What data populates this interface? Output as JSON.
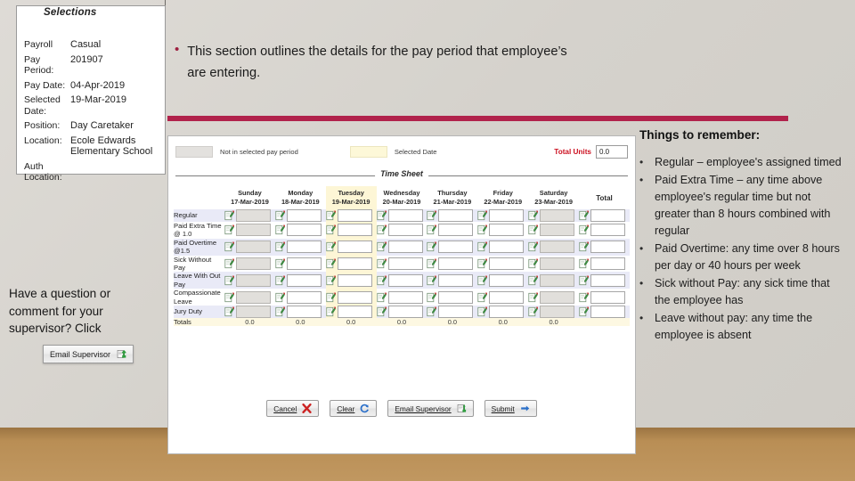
{
  "slide": {
    "bullet": {
      "marker": "•",
      "text": "This section outlines the details for the pay period that employee’s are entering."
    },
    "question_text": "Have a question or comment for your supervisor? Click",
    "floating_button": {
      "label": "Email Supervisor",
      "icon": "email-export-icon"
    }
  },
  "selections": {
    "legend": "Selections",
    "rows": [
      {
        "key": "Payroll",
        "value": "Casual"
      },
      {
        "key": "Pay Period:",
        "value": "201907"
      },
      {
        "key": "Pay Date:",
        "value": "04-Apr-2019"
      },
      {
        "key": "Selected Date:",
        "value": "19-Mar-2019"
      },
      {
        "key": "Position:",
        "value": "Day Caretaker"
      },
      {
        "key": "Location:",
        "value": "Ecole Edwards Elementary School"
      },
      {
        "key": "Auth Location:",
        "value": ""
      }
    ]
  },
  "timesheet": {
    "legend": {
      "not_in_period": "Not in selected pay period",
      "selected_date": "Selected Date",
      "total_units_label": "Total Units",
      "total_units_value": "0.0"
    },
    "section_title": "Time Sheet",
    "row_header_blank": "",
    "total_column_header": "Total",
    "days": [
      {
        "name": "Sunday",
        "date": "17-Mar-2019",
        "in_period": false,
        "selected": false
      },
      {
        "name": "Monday",
        "date": "18-Mar-2019",
        "in_period": true,
        "selected": false
      },
      {
        "name": "Tuesday",
        "date": "19-Mar-2019",
        "in_period": true,
        "selected": true
      },
      {
        "name": "Wednesday",
        "date": "20-Mar-2019",
        "in_period": true,
        "selected": false
      },
      {
        "name": "Thursday",
        "date": "21-Mar-2019",
        "in_period": true,
        "selected": false
      },
      {
        "name": "Friday",
        "date": "22-Mar-2019",
        "in_period": true,
        "selected": false
      },
      {
        "name": "Saturday",
        "date": "23-Mar-2019",
        "in_period": false,
        "selected": false
      }
    ],
    "rows": [
      {
        "label": "Regular",
        "values": [
          "",
          "",
          "",
          "",
          "",
          "",
          ""
        ],
        "total": ""
      },
      {
        "label": "Paid Extra Time @ 1.0",
        "values": [
          "",
          "",
          "",
          "",
          "",
          "",
          ""
        ],
        "total": ""
      },
      {
        "label": "Paid Overtime @1.5",
        "values": [
          "",
          "",
          "",
          "",
          "",
          "",
          ""
        ],
        "total": ""
      },
      {
        "label": "Sick Without Pay",
        "values": [
          "",
          "",
          "",
          "",
          "",
          "",
          ""
        ],
        "total": ""
      },
      {
        "label": "Leave With Out Pay",
        "values": [
          "",
          "",
          "",
          "",
          "",
          "",
          ""
        ],
        "total": ""
      },
      {
        "label": "Compassionate Leave",
        "values": [
          "",
          "",
          "",
          "",
          "",
          "",
          ""
        ],
        "total": ""
      },
      {
        "label": "Jury Duty",
        "values": [
          "",
          "",
          "",
          "",
          "",
          "",
          ""
        ],
        "total": ""
      }
    ],
    "totals": {
      "label": "Totals",
      "values": [
        "0.0",
        "0.0",
        "0.0",
        "0.0",
        "0.0",
        "0.0",
        "0.0"
      ],
      "total": ""
    },
    "buttons": [
      {
        "label": "Cancel",
        "icon": "red-x-icon",
        "accent": "#cc2222"
      },
      {
        "label": "Clear",
        "icon": "refresh-icon",
        "accent": "#2a6fc9"
      },
      {
        "label": "Email Supervisor",
        "icon": "email-export-icon",
        "accent": "#2f9e3f"
      },
      {
        "label": "Submit",
        "icon": "arrow-right-icon",
        "accent": "#2a6fc9"
      }
    ]
  },
  "notes": {
    "title": "Things to remember:",
    "items": [
      "Regular – employee's assigned timed",
      "Paid Extra Time – any time above employee's regular time but not greater than 8 hours combined with regular",
      "Paid Overtime: any time over 8 hours per day or 40 hours per week",
      "Sick without Pay: any sick time that the employee has",
      "Leave without pay:  any time the employee is absent"
    ]
  },
  "colors": {
    "divider_red": "#b1224b",
    "total_units_red": "#cc1020",
    "selected_day": "#fdf6d6",
    "out_of_period": "#e1dfdb"
  }
}
